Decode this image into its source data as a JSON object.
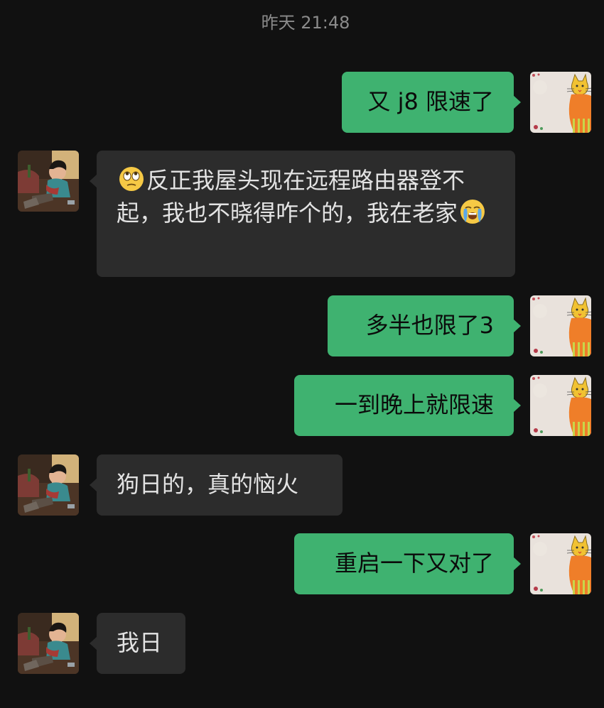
{
  "header": {
    "timestamp": "昨天 21:48"
  },
  "messages": [
    {
      "sender": "me",
      "text": "又 j8 限速了"
    },
    {
      "sender": "friend",
      "emoji_before": "face-with-rolling-eyes",
      "text": "反正我屋头现在远程路由器登不起，我也不晓得咋个的，我在老家",
      "emoji_after": "loudly-crying-face"
    },
    {
      "sender": "me",
      "text": "多半也限了3"
    },
    {
      "sender": "me",
      "text": "一到晚上就限速"
    },
    {
      "sender": "friend",
      "text": "狗日的，真的恼火"
    },
    {
      "sender": "me",
      "text": "重启一下又对了"
    },
    {
      "sender": "friend",
      "text": "我日"
    }
  ],
  "colors": {
    "background": "#111111",
    "me_bubble": "#3fb270",
    "friend_bubble": "#2c2c2c",
    "timestamp": "#8b8b8b"
  },
  "avatars": {
    "me": "cat-drawing-avatar",
    "friend": "boy-painting-avatar"
  }
}
